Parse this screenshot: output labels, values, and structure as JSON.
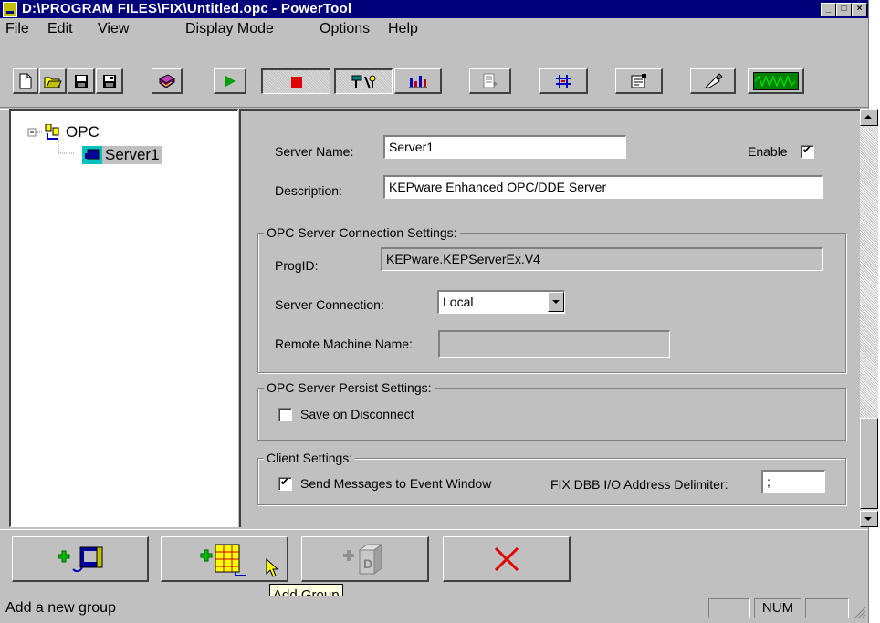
{
  "window": {
    "title": "D:\\PROGRAM FILES\\FIX\\Untitled.opc - PowerTool",
    "minimize": "_",
    "maximize": "□",
    "close": "×"
  },
  "menu": [
    "File",
    "Edit",
    "View",
    "Display Mode",
    "Options",
    "Help"
  ],
  "toolbar_icons": [
    "new-file-icon",
    "open-folder-icon",
    "save-icon",
    "save-as-icon",
    "book-icon",
    "play-icon",
    "stop-icon",
    "tools-icon",
    "bar-chart-icon",
    "properties-icon",
    "network-icon",
    "settings-sheet-icon",
    "probe-icon",
    "waveform-icon"
  ],
  "tree": {
    "root": "OPC",
    "child": "Server1"
  },
  "form": {
    "server_name_label": "Server Name:",
    "server_name_value": "Server1",
    "enable_label": "Enable",
    "enable_checked": true,
    "description_label": "Description:",
    "description_value": "KEPware Enhanced OPC/DDE Server",
    "conn_group": "OPC Server Connection Settings:",
    "progid_label": "ProgID:",
    "progid_value": "KEPware.KEPServerEx.V4",
    "server_conn_label": "Server Connection:",
    "server_conn_value": "Local",
    "remote_label": "Remote Machine Name:",
    "remote_value": "",
    "persist_group": "OPC Server Persist Settings:",
    "save_disconnect_label": "Save on Disconnect",
    "save_disconnect_checked": false,
    "client_group": "Client Settings:",
    "send_msgs_label": "Send Messages to Event Window",
    "send_msgs_checked": true,
    "delimiter_label": "FIX DBB I/O Address Delimiter:",
    "delimiter_value": ";"
  },
  "bottom_buttons": [
    "add-server-icon",
    "add-group-icon",
    "add-item-icon",
    "delete-icon"
  ],
  "tooltip": "Add Group",
  "status": {
    "text": "Add a new group",
    "num": "NUM"
  },
  "colors": {
    "title_bar": "#00007b",
    "face": "#c0c0c0",
    "tree_selection": "#c0c0c0",
    "delete_red": "#e00000"
  }
}
